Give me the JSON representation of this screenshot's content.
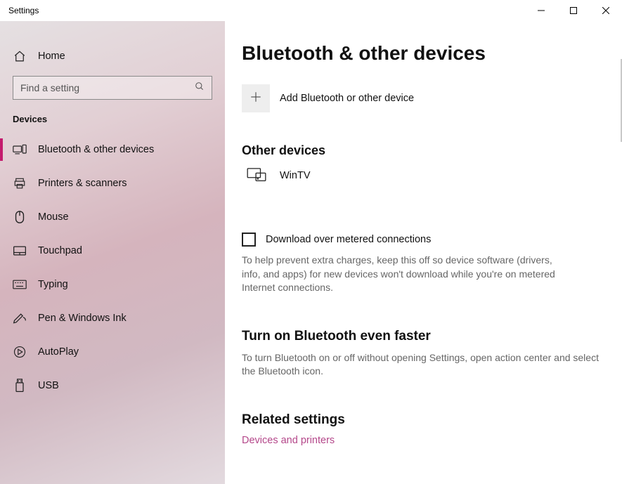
{
  "window": {
    "title": "Settings"
  },
  "sidebar": {
    "home_label": "Home",
    "search_placeholder": "Find a setting",
    "section_label": "Devices",
    "items": [
      {
        "label": "Bluetooth & other devices"
      },
      {
        "label": "Printers & scanners"
      },
      {
        "label": "Mouse"
      },
      {
        "label": "Touchpad"
      },
      {
        "label": "Typing"
      },
      {
        "label": "Pen & Windows Ink"
      },
      {
        "label": "AutoPlay"
      },
      {
        "label": "USB"
      }
    ]
  },
  "page": {
    "heading": "Bluetooth & other devices",
    "add_label": "Add Bluetooth or other device",
    "other_devices_heading": "Other devices",
    "device_name": "WinTV",
    "metered_label": "Download over metered connections",
    "metered_help": "To help prevent extra charges, keep this off so device software (drivers, info, and apps) for new devices won't download while you're on metered Internet connections.",
    "faster_heading": "Turn on Bluetooth even faster",
    "faster_text": "To turn Bluetooth on or off without opening Settings, open action center and select the Bluetooth icon.",
    "related_heading": "Related settings",
    "related_link": "Devices and printers"
  }
}
